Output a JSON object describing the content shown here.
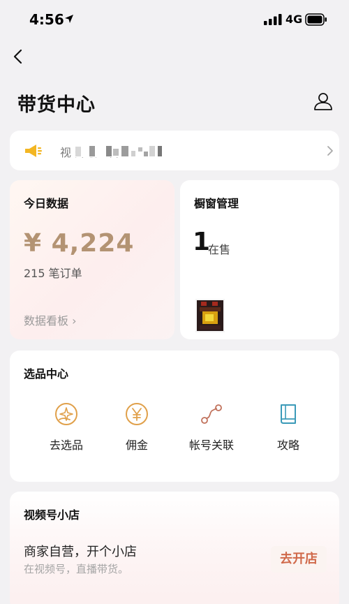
{
  "status_bar": {
    "time": "4:56",
    "network": "4G"
  },
  "header": {
    "title": "带货中心"
  },
  "notice": {
    "text": "视                       升级公告"
  },
  "today_data": {
    "title": "今日数据",
    "amount": "¥ 4,224",
    "orders": "215 笔订单",
    "dashboard_link": "数据看板 ›"
  },
  "window_mgmt": {
    "title": "橱窗管理",
    "count": "1",
    "count_label": "在售"
  },
  "selection_center": {
    "title": "选品中心",
    "items": [
      {
        "label": "去选品",
        "icon": "compass-hand-icon"
      },
      {
        "label": "佣金",
        "icon": "yen-icon"
      },
      {
        "label": "帐号关联",
        "icon": "link-icon"
      },
      {
        "label": "攻略",
        "icon": "book-icon"
      }
    ]
  },
  "shop": {
    "title": "视频号小店",
    "headline": "商家自营，开个小店",
    "subtitle": "在视频号，直播带货。",
    "button": "去开店"
  },
  "colors": {
    "accent_gold": "#b39373",
    "icon_orange": "#e0a04a",
    "link_brown": "#c0705a",
    "book_teal": "#3a9ab8",
    "open_red": "#d0694a"
  }
}
